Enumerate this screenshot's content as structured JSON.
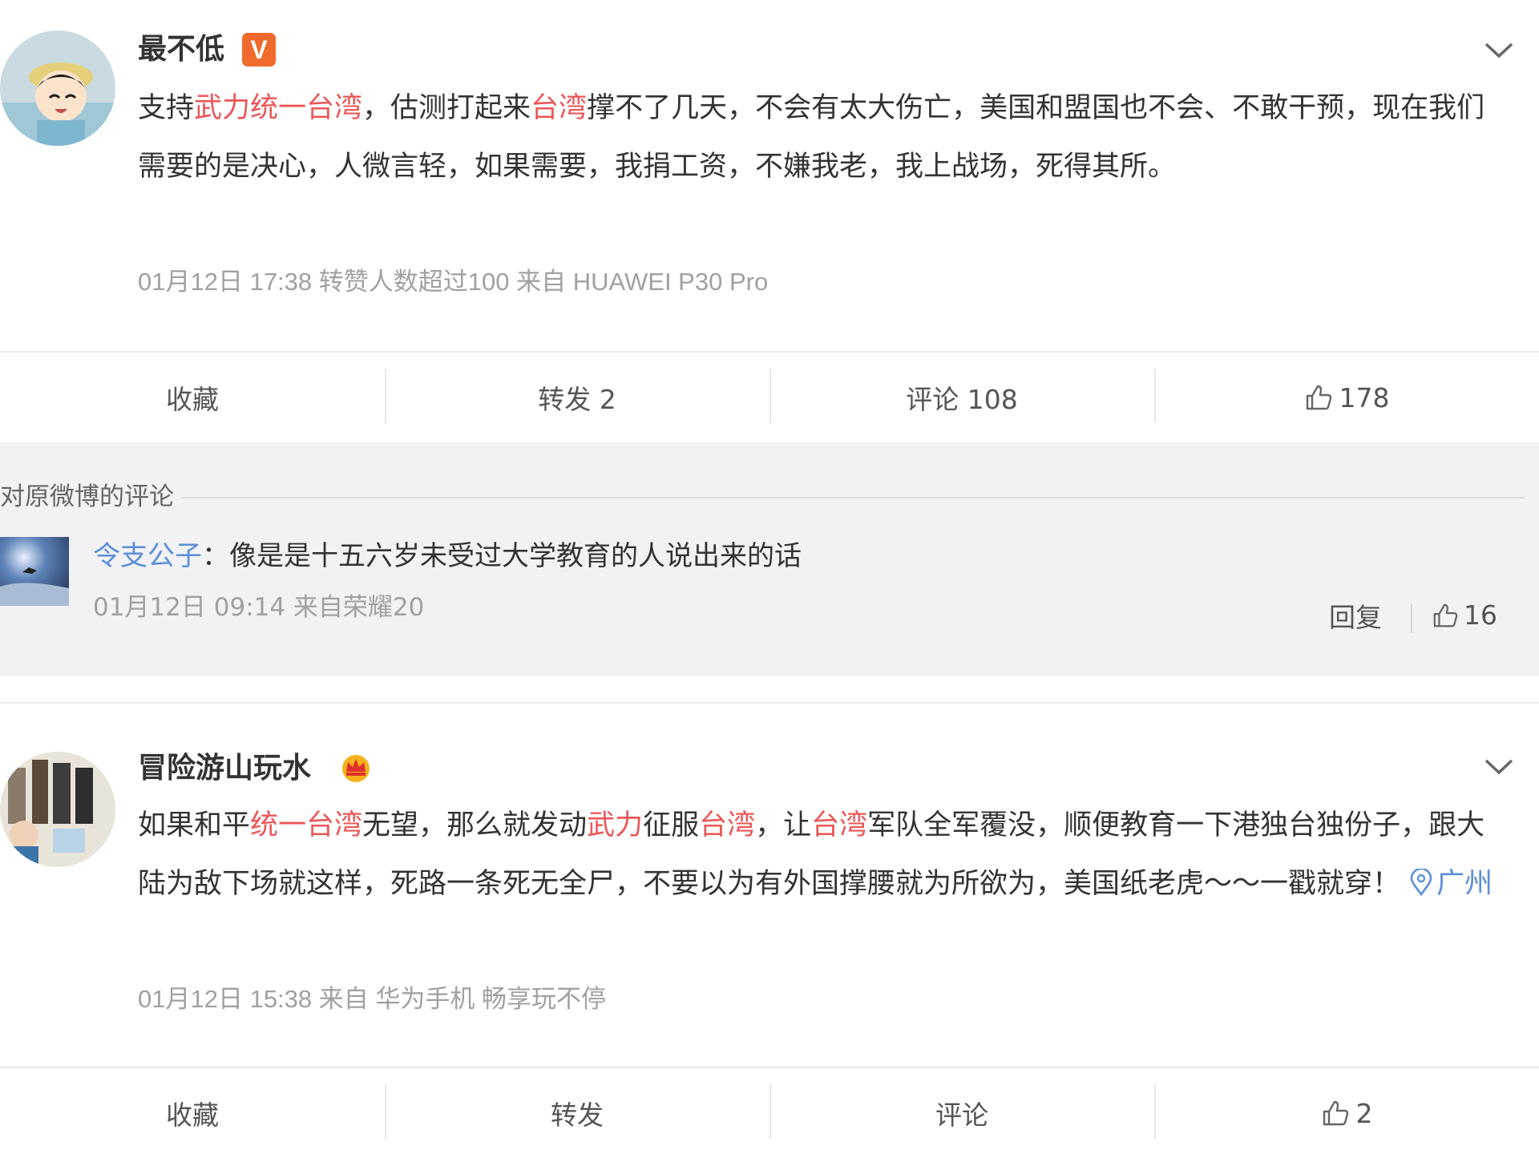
{
  "post1": {
    "username": "最不低",
    "badge": "V",
    "content_parts": [
      {
        "text": "支持",
        "hl": false
      },
      {
        "text": "武力统一台湾",
        "hl": true
      },
      {
        "text": "，估测打起来",
        "hl": false
      },
      {
        "text": "台湾",
        "hl": true
      },
      {
        "text": "撑不了几天，不会有太大伤亡，美国和盟国也不会、不敢干预，现在我们需要的是决心，人微言轻，如果需要，我捐工资，不嫌我老，我上战场，死得其所。",
        "hl": false
      }
    ],
    "meta": "01月12日 17:38 转赞人数超过100  来自 HUAWEI P30 Pro",
    "actions": {
      "favorite": "收藏",
      "repost": "转发 2",
      "comment": "评论 108",
      "like": "178"
    }
  },
  "original_comments": {
    "title": "对原微博的评论",
    "comment": {
      "user": "令支公子",
      "separator": "：",
      "text": "像是是十五六岁未受过大学教育的人说出来的话",
      "meta": "01月12日 09:14 来自荣耀20",
      "reply": "回复",
      "likes": "16"
    }
  },
  "post2": {
    "username": "冒险游山玩水",
    "content_parts": [
      {
        "text": "如果和平",
        "hl": false
      },
      {
        "text": "统一台湾",
        "hl": true
      },
      {
        "text": "无望，那么就发动",
        "hl": false
      },
      {
        "text": "武力",
        "hl": true
      },
      {
        "text": "征服",
        "hl": false
      },
      {
        "text": "台湾",
        "hl": true
      },
      {
        "text": "，让",
        "hl": false
      },
      {
        "text": "台湾",
        "hl": true
      },
      {
        "text": "军队全军覆没，顺便教育一下港独台独份子，跟大陆为敌下场就这样，死路一条死无全尸，不要以为有外国撑腰就为所欲为，美国纸老虎～～一戳就穿！ ",
        "hl": false
      }
    ],
    "location": "广州",
    "meta": "01月12日 15:38  来自 华为手机 畅享玩不停",
    "actions": {
      "favorite": "收藏",
      "repost": "转发",
      "comment": "评论",
      "like": "2"
    }
  },
  "icons": {
    "verified": "verified-v-icon",
    "crown": "crown-icon",
    "chevron": "chevron-down-icon",
    "like": "thumbs-up-icon",
    "location": "location-pin-icon"
  },
  "colors": {
    "highlight": "#eb5656",
    "link": "#5b8fd8",
    "badge": "#ef6a2c",
    "comment_bg": "#f2f2f5"
  }
}
